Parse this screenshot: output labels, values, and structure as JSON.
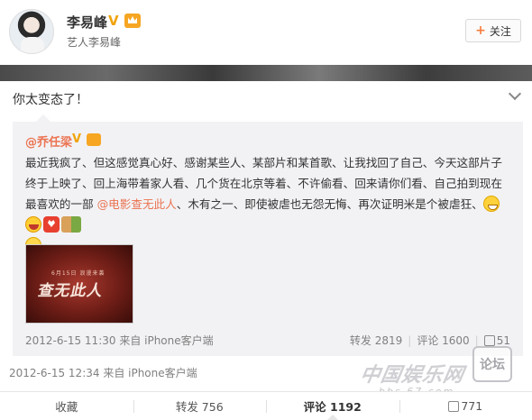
{
  "header": {
    "username": "李易峰",
    "verified_mark": "V",
    "verification": "艺人李易峰",
    "follow_label": "关注",
    "follow_plus": "+"
  },
  "post": {
    "text": "你太变态了！",
    "meta": "2012-6-15 12:34 来自 iPhone客户端"
  },
  "repost": {
    "username": "@乔任梁",
    "verified_mark": "V",
    "body_part1": "最近我疯了、但这感觉真心好、感谢某些人、某部片和某首歌、让我找回了自己、今天这部片子终于上映了、回上海带着家人看、几个货在北京等着、不许偷看、回来请你们看、自己拍到现在最喜欢的一部 ",
    "mention": "@电影查无此人",
    "body_part2": "、木有之一、即使被虐也无怨无悔、再次证明米是个被虐狂、",
    "image": {
      "small_text": "6月15日 浪漫来袭",
      "title": "查无此人"
    },
    "meta": "2012-6-15 11:30 来自 iPhone客户端",
    "actions": {
      "repost": "转发 2819",
      "comment": "评论 1600",
      "like": "51",
      "separator": "|"
    }
  },
  "action_bar": {
    "favorite": "收藏",
    "repost": "转发 756",
    "comment": "评论 1192",
    "like": "771"
  },
  "watermark": {
    "brand": "中国娱乐网",
    "url": "bbs.67.com",
    "forum": "论坛"
  },
  "colors": {
    "link": "#eb7350",
    "verified": "#f0a30a",
    "repost_bg": "#f2f2f5",
    "meta": "#808080"
  }
}
